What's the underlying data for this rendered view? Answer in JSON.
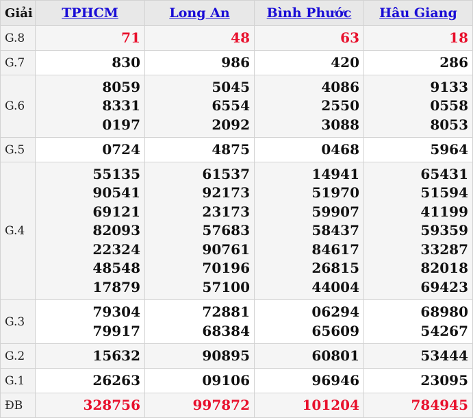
{
  "header": {
    "prize_col": "Giải",
    "provinces": [
      "TPHCM",
      "Long An",
      "Bình Phước",
      "Hâu Giang"
    ]
  },
  "colors": {
    "link": "#1a0dd6",
    "highlight_red": "#e8102c"
  },
  "rows": [
    {
      "label": "G.8",
      "values": [
        [
          "71"
        ],
        [
          "48"
        ],
        [
          "63"
        ],
        [
          "18"
        ]
      ]
    },
    {
      "label": "G.7",
      "values": [
        [
          "830"
        ],
        [
          "986"
        ],
        [
          "420"
        ],
        [
          "286"
        ]
      ]
    },
    {
      "label": "G.6",
      "values": [
        [
          "8059",
          "8331",
          "0197"
        ],
        [
          "5045",
          "6554",
          "2092"
        ],
        [
          "4086",
          "2550",
          "3088"
        ],
        [
          "9133",
          "0558",
          "8053"
        ]
      ]
    },
    {
      "label": "G.5",
      "values": [
        [
          "0724"
        ],
        [
          "4875"
        ],
        [
          "0468"
        ],
        [
          "5964"
        ]
      ]
    },
    {
      "label": "G.4",
      "values": [
        [
          "55135",
          "90541",
          "69121",
          "82093",
          "22324",
          "48548",
          "17879"
        ],
        [
          "61537",
          "92173",
          "23173",
          "57683",
          "90761",
          "70196",
          "57100"
        ],
        [
          "14941",
          "51970",
          "59907",
          "58437",
          "84617",
          "26815",
          "44004"
        ],
        [
          "65431",
          "51594",
          "41199",
          "59359",
          "33287",
          "82018",
          "69423"
        ]
      ]
    },
    {
      "label": "G.3",
      "values": [
        [
          "79304",
          "79917"
        ],
        [
          "72881",
          "68384"
        ],
        [
          "06294",
          "65609"
        ],
        [
          "68980",
          "54267"
        ]
      ]
    },
    {
      "label": "G.2",
      "values": [
        [
          "15632"
        ],
        [
          "90895"
        ],
        [
          "60801"
        ],
        [
          "53444"
        ]
      ]
    },
    {
      "label": "G.1",
      "values": [
        [
          "26263"
        ],
        [
          "09106"
        ],
        [
          "96946"
        ],
        [
          "23095"
        ]
      ]
    },
    {
      "label": "ĐB",
      "values": [
        [
          "328756"
        ],
        [
          "997872"
        ],
        [
          "101204"
        ],
        [
          "784945"
        ]
      ]
    }
  ]
}
